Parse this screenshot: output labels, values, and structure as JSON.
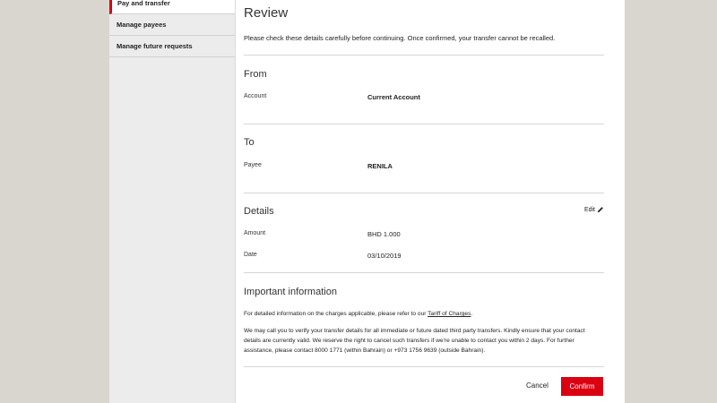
{
  "sidebar": {
    "items": [
      {
        "label": "Pay and transfer",
        "active": true
      },
      {
        "label": "Manage payees",
        "active": false
      },
      {
        "label": "Manage future requests",
        "active": false
      }
    ]
  },
  "review": {
    "title": "Review",
    "intro": "Please check these details carefully before continuing. Once confirmed, your transfer cannot be recalled."
  },
  "from": {
    "title": "From",
    "account_label": "Account",
    "account_value": "Current Account"
  },
  "to": {
    "title": "To",
    "payee_label": "Payee",
    "payee_value": "RENILA"
  },
  "details": {
    "title": "Details",
    "edit_label": "Edit",
    "amount_label": "Amount",
    "amount_value": "BHD 1.000",
    "date_label": "Date",
    "date_value": "03/10/2019"
  },
  "important": {
    "title": "Important information",
    "para1_prefix": "For detailed information on the charges applicable, please refer to our ",
    "para1_link": "Tariff of Charges",
    "para1_suffix": ".",
    "para2": "We may call you to verify your transfer details for all immediate or future dated third party transfers. Kindly ensure that your contact details are currently valid. We reserve the right to cancel such transfers if we're unable to contact you within 2 days. For further assistance, please contact 8000 1771 (within Bahrain) or +973 1756 9639 (outside Bahrain)."
  },
  "actions": {
    "cancel_label": "Cancel",
    "confirm_label": "Confirm"
  },
  "colors": {
    "accent": "#db0011",
    "background": "#d9d6cf",
    "sidebar": "#ececec"
  }
}
